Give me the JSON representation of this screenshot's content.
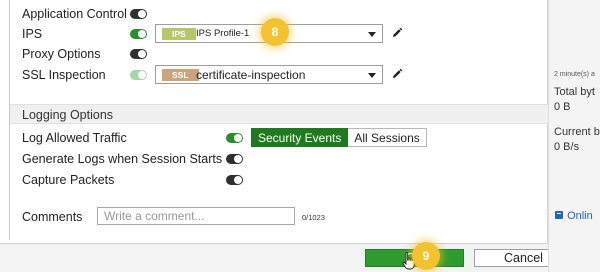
{
  "form": {
    "rows": [
      {
        "label": "Application Control",
        "state": "off"
      },
      {
        "label": "IPS",
        "state": "on"
      },
      {
        "label": "Proxy Options",
        "state": "off"
      },
      {
        "label": "SSL Inspection",
        "state": "on-faded"
      }
    ],
    "ips_select": {
      "tag": "IPS",
      "value": "IPS Profile-1",
      "tag_color": "#b5c76a"
    },
    "ssl_select": {
      "tag": "SSL",
      "value": "certificate-inspection",
      "tag_color": "#c9a47d"
    }
  },
  "logging": {
    "section_title": "Logging Options",
    "log_allowed_traffic": "Log Allowed Traffic",
    "segment": {
      "active": "Security Events",
      "inactive": "All Sessions"
    },
    "generate_logs": "Generate Logs when Session Starts",
    "capture_packets": "Capture Packets"
  },
  "comments": {
    "label": "Comments",
    "placeholder": "Write a comment...",
    "counter": "0/1023"
  },
  "footer": {
    "ok_label": "OK",
    "cancel_label": "Cancel"
  },
  "badges": {
    "step8": "8",
    "step9": "9"
  },
  "right_panel": {
    "timestamp": "2 minute(s) a",
    "total_label": "Total byt",
    "total_value": "0 B",
    "current_label": "Current b",
    "current_value": "0 B/s",
    "online_label": "Onlin"
  },
  "colors": {
    "accent_green": "#2e8b2e",
    "ok_green": "#2f9a2f",
    "badge_yellow": "#f2c230"
  }
}
